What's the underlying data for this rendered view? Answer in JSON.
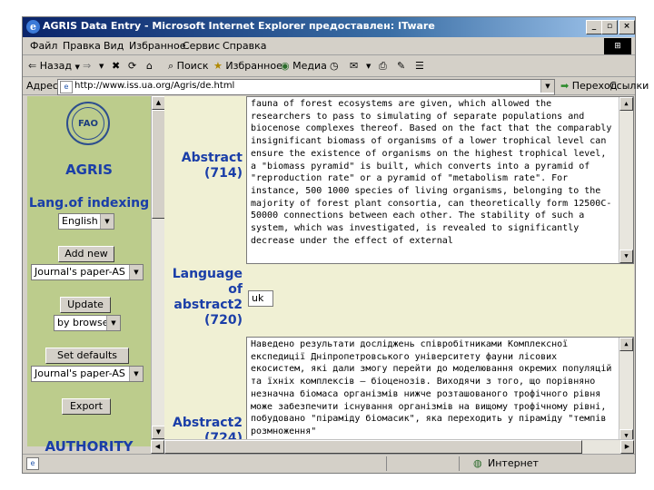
{
  "window": {
    "title": "AGRIS Data Entry - Microsoft Internet Explorer предоставлен: ITware",
    "controls": [
      "_",
      "▫",
      "×"
    ]
  },
  "menu": [
    "Файл",
    "Правка",
    "Вид",
    "Избранное",
    "Сервис",
    "Справка"
  ],
  "toolbar": {
    "back": "Назад",
    "search": "Поиск",
    "favorites": "Избранное",
    "media": "Медиа"
  },
  "address": {
    "label": "Адрес:",
    "url": "http://www.iss.ua.org/Agris/de.html",
    "go": "Переход",
    "links": "Ссылки"
  },
  "left": {
    "logo_text": "FAO",
    "agris": "AGRIS",
    "lang_heading": "Lang.of indexing",
    "lang_value": "English",
    "add_new": "Add new",
    "doc_type_1": "Journal's paper-AS",
    "update": "Update",
    "browse_value": "by browse",
    "set_defaults": "Set defaults",
    "doc_type_2": "Journal's paper-AS",
    "export": "Export",
    "authority": "AUTHORITY"
  },
  "right": {
    "abstract_label_1": "Abstract",
    "abstract_code_1": "(714)",
    "abstract_text_1": "fauna of forest ecosystems are given, which allowed the researchers to pass to simulating of separate populations and biocenose complexes thereof. Based on the fact that the comparably insignificant biomass of organisms of a lower trophical level can ensure the existence of organisms on the highest trophical level, a \"biomass pyramid\" is built, which converts into a pyramid of \"reproduction rate\" or a pyramid of \"metabolism rate\". For instance, 500 1000 species of living organisms, belonging to the majority of forest plant consortia, can theoretically form 12500C-50000 connections between each other. The stability of such a system, which was investigated, is revealed to significantly decrease under the effect of external",
    "lang_label_1": "Language",
    "lang_label_2": "of",
    "lang_label_3": "abstract2",
    "lang_code": "(720)",
    "lang_abstract_value": "uk",
    "abstract_label_2": "Abstract2",
    "abstract_code_2": "(724)",
    "abstract_text_2": "Наведено результати досліджень співробітниками Комплексної експедиції Дніпропетровського університету фауни лісових екосистем, які дали змогу перейти до моделювання окремих популяцій та їхніх комплексів – біоценозів. Виходячи з того, що порівняно незначна біомаса організмів нижче розташованого трофічного рівня може забезпечити існування організмів на вищому трофічному рівні, побудовано \"піраміду біомасик\", яка переходить у піраміду \"темпів розмноження\""
  },
  "status": {
    "zone": "Интернет"
  }
}
